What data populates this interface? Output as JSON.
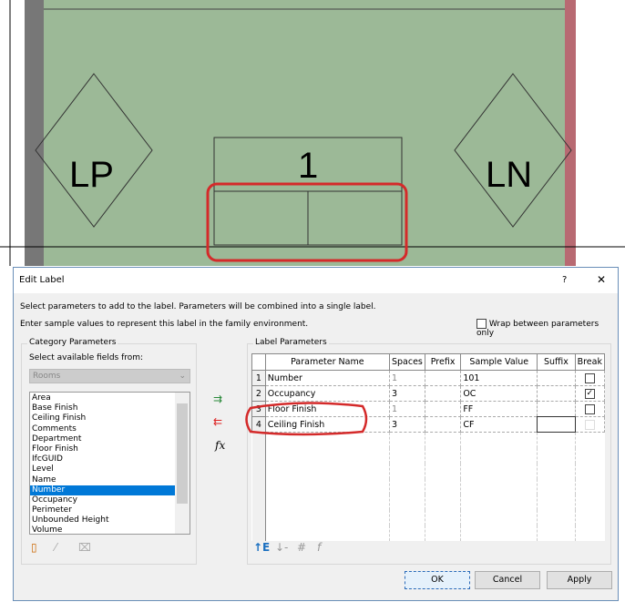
{
  "plan": {
    "tags": [
      "LP",
      "LN"
    ],
    "room_label": "1",
    "colors": {
      "floor": "#9cb997",
      "highlight": "#d42a2a",
      "wall_right": "#b86a72"
    }
  },
  "dialog": {
    "title": "Edit Label",
    "help": "?",
    "close": "✕",
    "instruction1": "Select parameters to add to the label.  Parameters will be combined into a single label.",
    "instruction2": "Enter sample values to represent this label in the family environment.",
    "wrap_label": "Wrap between parameters only",
    "wrap_checked": false,
    "category": {
      "group_label": "Category Parameters",
      "select_label": "Select available fields from:",
      "select_value": "Rooms",
      "fields": [
        "Area",
        "Base Finish",
        "Ceiling Finish",
        "Comments",
        "Department",
        "Floor Finish",
        "IfcGUID",
        "Level",
        "Name",
        "Number",
        "Occupancy",
        "Perimeter",
        "Unbounded Height",
        "Volume"
      ],
      "selected": "Number"
    },
    "label_params": {
      "group_label": "Label Parameters",
      "columns": [
        "",
        "Parameter Name",
        "Spaces",
        "Prefix",
        "Sample Value",
        "Suffix",
        "Break"
      ],
      "rows": [
        {
          "n": "1",
          "name": "Number",
          "spaces": "1",
          "prefix": "",
          "sample": "101",
          "suffix": "",
          "brk": false
        },
        {
          "n": "2",
          "name": "Occupancy",
          "spaces": "3",
          "prefix": "",
          "sample": "OC",
          "suffix": "",
          "brk": true
        },
        {
          "n": "3",
          "name": "Floor Finish",
          "spaces": "1",
          "prefix": "",
          "sample": "FF",
          "suffix": "",
          "brk": false
        },
        {
          "n": "4",
          "name": "Ceiling Finish",
          "spaces": "3",
          "prefix": "",
          "sample": "CF",
          "suffix": "",
          "brk": false
        }
      ]
    },
    "buttons": {
      "ok": "OK",
      "cancel": "Cancel",
      "apply": "Apply"
    }
  }
}
